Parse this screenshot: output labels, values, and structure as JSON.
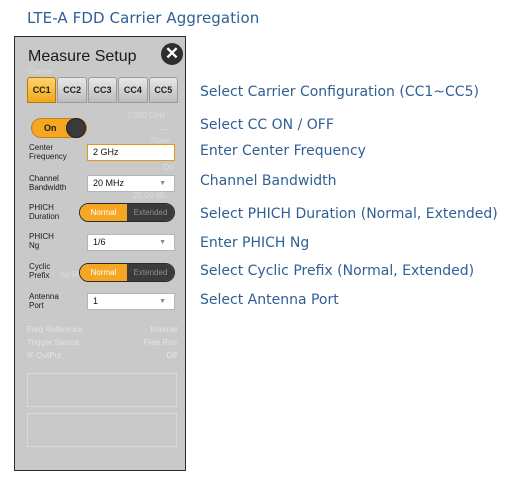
{
  "doc_title": "LTE-A FDD Carrier Aggregation",
  "panel": {
    "title": "Measure Setup",
    "close_glyph": "✕",
    "ghost_texts": {
      "left_hint": "Carrier",
      "freq_hint": "2.000 GHz",
      "dash_hint": "—",
      "none_hint": "None",
      "on_hint": "On",
      "bw_hint": "20.00 dB",
      "prefix_hint": "Ap Mo"
    },
    "tabs": [
      "CC1",
      "CC2",
      "CC3",
      "CC4",
      "CC5"
    ],
    "active_tab": "CC1",
    "cc_state": "On",
    "center_frequency": {
      "label1": "Center",
      "label2": "Frequency",
      "value": "2 GHz"
    },
    "channel_bandwidth": {
      "label1": "Channel",
      "label2": "Bandwidth",
      "value": "20 MHz"
    },
    "phich_duration": {
      "label1": "PHICH",
      "label2": "Duration",
      "options": [
        "Normal",
        "Extended"
      ],
      "selected": "Normal"
    },
    "phich_ng": {
      "label1": "PHICH",
      "label2": "Ng",
      "value": "1/6"
    },
    "cyclic_prefix": {
      "label1": "Cyclic",
      "label2": "Prefix",
      "options": [
        "Normal",
        "Extended"
      ],
      "selected": "Normal"
    },
    "antenna_port": {
      "label1": "Antenna",
      "label2": "Port",
      "value": "1"
    },
    "dimmed": [
      {
        "label": "Freq Reference",
        "value": "Internal"
      },
      {
        "label": "Trigger Source",
        "value": "Free Run"
      },
      {
        "label": "IF OutPut",
        "value": "Off"
      }
    ]
  },
  "descriptions": [
    "Select Carrier Configuration (CC1~CC5)",
    "Select CC ON / OFF",
    "Enter Center Frequency",
    "Channel Bandwidth",
    "Select PHICH Duration (Normal, Extended)",
    "Enter PHICH Ng",
    "Select Cyclic Prefix (Normal, Extended)",
    "Select Antenna Port"
  ],
  "colors": {
    "accent": "#f5a623",
    "text_blue": "#2f5f96",
    "panel_bg": "#c9c9c9"
  }
}
